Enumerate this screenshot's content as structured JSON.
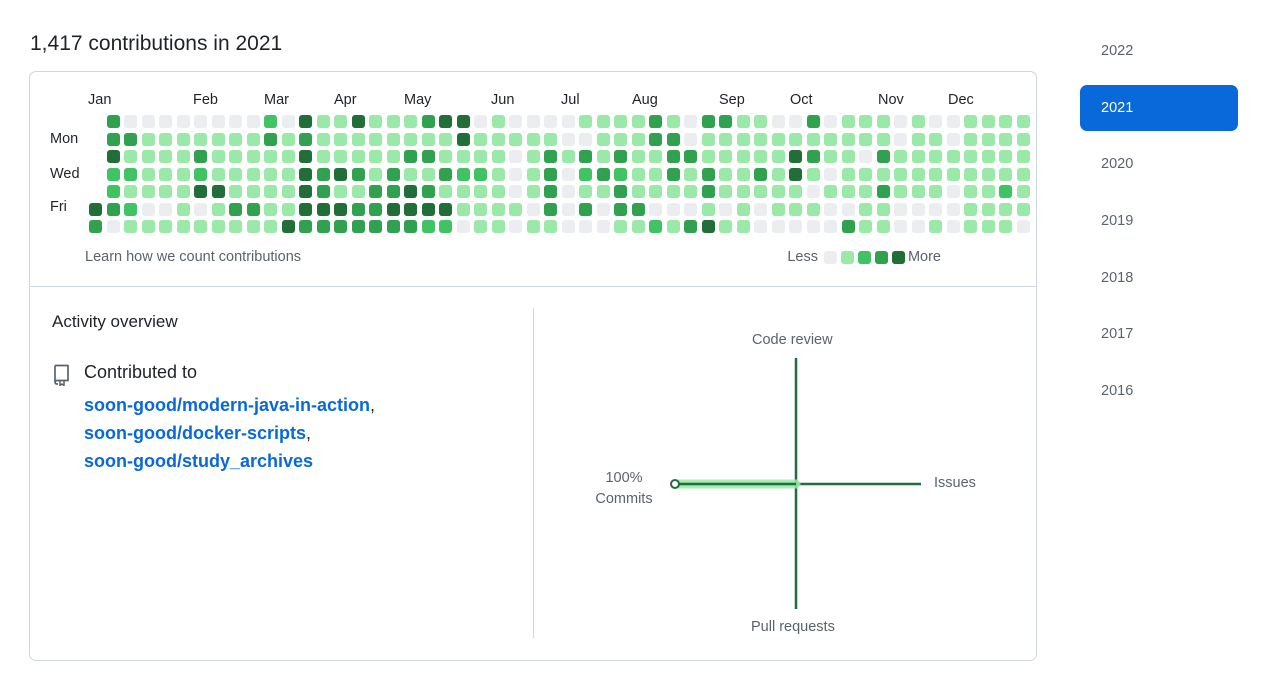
{
  "heading": "1,417 contributions in 2021",
  "colors": {
    "level0": "#ebedf0",
    "level1": "#9be9a8",
    "level2": "#40c463",
    "level3": "#30a14e",
    "level4": "#216e39",
    "accent": "#0969da",
    "radar_line": "#1f6f3a",
    "radar_highlight": "#9be9a8"
  },
  "calendar": {
    "months": [
      "Jan",
      "Feb",
      "Mar",
      "Apr",
      "May",
      "Jun",
      "Jul",
      "Aug",
      "Sep",
      "Oct",
      "Nov",
      "Dec"
    ],
    "day_labels": [
      "Mon",
      "Wed",
      "Fri"
    ],
    "weeks": [
      [
        null,
        null,
        null,
        null,
        null,
        4,
        3
      ],
      [
        3,
        3,
        4,
        2,
        2,
        3,
        0
      ],
      [
        0,
        3,
        1,
        2,
        1,
        2,
        1
      ],
      [
        0,
        1,
        1,
        1,
        1,
        0,
        1
      ],
      [
        0,
        1,
        1,
        1,
        1,
        0,
        1
      ],
      [
        0,
        1,
        1,
        1,
        1,
        1,
        1
      ],
      [
        0,
        1,
        3,
        2,
        4,
        0,
        1
      ],
      [
        0,
        1,
        1,
        1,
        4,
        1,
        1
      ],
      [
        0,
        1,
        1,
        1,
        1,
        3,
        1
      ],
      [
        0,
        1,
        1,
        1,
        1,
        3,
        1
      ],
      [
        2,
        3,
        1,
        1,
        1,
        1,
        1
      ],
      [
        0,
        1,
        1,
        1,
        1,
        1,
        5
      ],
      [
        4,
        3,
        5,
        5,
        4,
        4,
        3
      ],
      [
        1,
        1,
        1,
        3,
        3,
        5,
        3
      ],
      [
        1,
        1,
        1,
        5,
        1,
        5,
        3
      ],
      [
        4,
        1,
        1,
        3,
        1,
        3,
        3
      ],
      [
        1,
        1,
        1,
        1,
        3,
        3,
        3
      ],
      [
        1,
        1,
        1,
        3,
        3,
        4,
        3
      ],
      [
        1,
        1,
        3,
        1,
        4,
        5,
        3
      ],
      [
        3,
        1,
        3,
        1,
        3,
        5,
        2
      ],
      [
        4,
        1,
        1,
        3,
        1,
        5,
        2
      ],
      [
        4,
        5,
        1,
        2,
        1,
        1,
        0
      ],
      [
        0,
        1,
        1,
        2,
        1,
        1,
        1
      ],
      [
        1,
        1,
        1,
        1,
        1,
        1,
        1
      ],
      [
        0,
        1,
        0,
        0,
        0,
        1,
        0
      ],
      [
        0,
        1,
        1,
        1,
        1,
        0,
        1
      ],
      [
        0,
        1,
        3,
        3,
        3,
        3,
        1
      ],
      [
        0,
        0,
        1,
        0,
        0,
        0,
        0
      ],
      [
        1,
        0,
        3,
        2,
        1,
        3,
        0
      ],
      [
        1,
        1,
        1,
        3,
        1,
        0,
        0
      ],
      [
        1,
        1,
        3,
        2,
        3,
        3,
        1
      ],
      [
        1,
        1,
        1,
        1,
        1,
        3,
        1
      ],
      [
        3,
        3,
        1,
        1,
        1,
        0,
        2
      ],
      [
        1,
        3,
        3,
        3,
        1,
        0,
        1
      ],
      [
        0,
        0,
        3,
        1,
        1,
        0,
        3
      ],
      [
        3,
        1,
        1,
        3,
        3,
        1,
        4
      ],
      [
        3,
        1,
        1,
        1,
        1,
        0,
        1
      ],
      [
        1,
        1,
        1,
        1,
        1,
        1,
        1
      ],
      [
        1,
        1,
        1,
        3,
        1,
        0,
        0
      ],
      [
        0,
        1,
        1,
        1,
        1,
        1,
        0
      ],
      [
        0,
        1,
        5,
        4,
        1,
        1,
        0
      ],
      [
        3,
        1,
        3,
        1,
        0,
        1,
        0
      ],
      [
        0,
        1,
        1,
        0,
        1,
        0,
        0
      ],
      [
        1,
        1,
        1,
        1,
        1,
        0,
        3
      ],
      [
        1,
        1,
        0,
        1,
        1,
        1,
        1
      ],
      [
        1,
        1,
        3,
        1,
        3,
        1,
        1
      ],
      [
        0,
        0,
        1,
        1,
        1,
        0,
        0
      ],
      [
        1,
        1,
        1,
        1,
        1,
        0,
        0
      ],
      [
        0,
        1,
        1,
        1,
        1,
        0,
        1
      ],
      [
        0,
        0,
        1,
        1,
        0,
        0,
        0
      ],
      [
        1,
        1,
        1,
        1,
        1,
        1,
        1
      ],
      [
        1,
        1,
        1,
        1,
        1,
        1,
        1
      ],
      [
        1,
        1,
        1,
        1,
        2,
        1,
        1
      ],
      [
        1,
        1,
        1,
        1,
        1,
        1,
        0
      ]
    ],
    "learn_link": "Learn how we count contributions",
    "legend_less": "Less",
    "legend_more": "More"
  },
  "activity": {
    "title": "Activity overview",
    "contributed_to": "Contributed to",
    "repos": [
      "soon-good/modern-java-in-action",
      "soon-good/docker-scripts",
      "soon-good/study_archives"
    ],
    "radar": {
      "top": "Code review",
      "right": "Issues",
      "bottom": "Pull requests",
      "left_percent": "100%",
      "left_label": "Commits"
    }
  },
  "years": [
    "2022",
    "2021",
    "2020",
    "2019",
    "2018",
    "2017",
    "2016"
  ],
  "selected_year": "2021"
}
